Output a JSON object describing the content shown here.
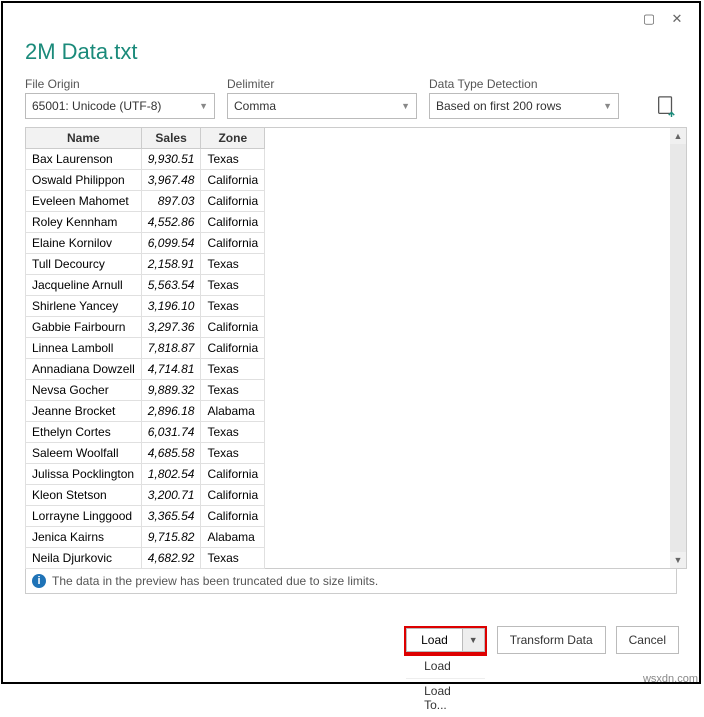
{
  "titlebar": {
    "maximize": "▢",
    "close": "✕"
  },
  "title": "2M Data.txt",
  "origin": {
    "label": "File Origin",
    "value": "65001: Unicode (UTF-8)"
  },
  "delimiter": {
    "label": "Delimiter",
    "value": "Comma"
  },
  "detection": {
    "label": "Data Type Detection",
    "value": "Based on first 200 rows"
  },
  "columns": {
    "c0": "Name",
    "c1": "Sales",
    "c2": "Zone"
  },
  "rows": [
    {
      "name": "Bax Laurenson",
      "sales": "9,930.51",
      "zone": "Texas"
    },
    {
      "name": "Oswald Philippon",
      "sales": "3,967.48",
      "zone": "California"
    },
    {
      "name": "Eveleen Mahomet",
      "sales": "897.03",
      "zone": "California"
    },
    {
      "name": "Roley Kennham",
      "sales": "4,552.86",
      "zone": "California"
    },
    {
      "name": "Elaine Kornilov",
      "sales": "6,099.54",
      "zone": "California"
    },
    {
      "name": "Tull Decourcy",
      "sales": "2,158.91",
      "zone": "Texas"
    },
    {
      "name": "Jacqueline Arnull",
      "sales": "5,563.54",
      "zone": "Texas"
    },
    {
      "name": "Shirlene Yancey",
      "sales": "3,196.10",
      "zone": "Texas"
    },
    {
      "name": "Gabbie Fairbourn",
      "sales": "3,297.36",
      "zone": "California"
    },
    {
      "name": "Linnea Lamboll",
      "sales": "7,818.87",
      "zone": "California"
    },
    {
      "name": "Annadiana Dowzell",
      "sales": "4,714.81",
      "zone": "Texas"
    },
    {
      "name": "Nevsa Gocher",
      "sales": "9,889.32",
      "zone": "Texas"
    },
    {
      "name": "Jeanne Brocket",
      "sales": "2,896.18",
      "zone": "Alabama"
    },
    {
      "name": "Ethelyn Cortes",
      "sales": "6,031.74",
      "zone": "Texas"
    },
    {
      "name": "Saleem Woolfall",
      "sales": "4,685.58",
      "zone": "Texas"
    },
    {
      "name": "Julissa Pocklington",
      "sales": "1,802.54",
      "zone": "California"
    },
    {
      "name": "Kleon Stetson",
      "sales": "3,200.71",
      "zone": "California"
    },
    {
      "name": "Lorrayne Linggood",
      "sales": "3,365.54",
      "zone": "California"
    },
    {
      "name": "Jenica Kairns",
      "sales": "9,715.82",
      "zone": "Alabama"
    },
    {
      "name": "Neila Djurkovic",
      "sales": "4,682.92",
      "zone": "Texas"
    }
  ],
  "notice": "The data in the preview has been truncated due to size limits.",
  "buttons": {
    "load": "Load",
    "transform": "Transform Data",
    "cancel": "Cancel"
  },
  "menu": {
    "load": "Load",
    "loadto": "Load To..."
  },
  "watermark": "wsxdn.com"
}
